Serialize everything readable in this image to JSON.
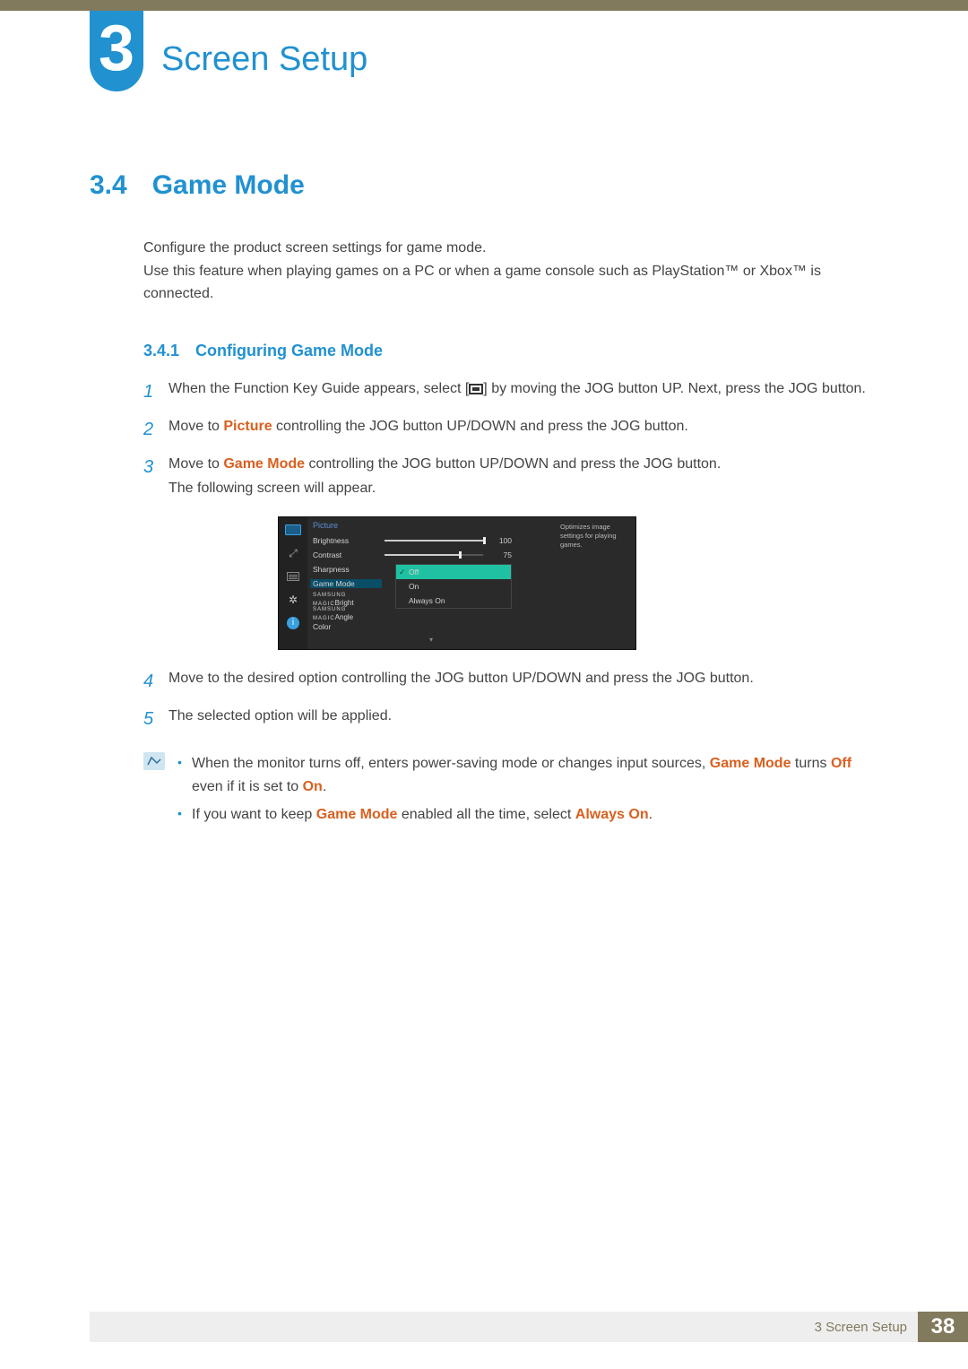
{
  "chapter": {
    "number": "3",
    "title": "Screen Setup"
  },
  "section": {
    "number": "3.4",
    "title": "Game Mode"
  },
  "intro": {
    "p1": "Configure the product screen settings for game mode.",
    "p2": "Use this feature when playing games on a PC or when a game console such as PlayStation™ or Xbox™ is connected."
  },
  "subsection": {
    "number": "3.4.1",
    "title": "Configuring Game Mode"
  },
  "steps": {
    "s1": {
      "num": "1",
      "pre": "When the Function Key Guide appears, select [",
      "post": "] by moving the JOG button UP. Next, press the JOG button."
    },
    "s2": {
      "num": "2",
      "a": "Move to ",
      "kw": "Picture",
      "b": " controlling the JOG button UP/DOWN and press the JOG button."
    },
    "s3": {
      "num": "3",
      "a": "Move to ",
      "kw": "Game Mode",
      "b": " controlling the JOG button UP/DOWN and press the JOG button.",
      "c": "The following screen will appear."
    },
    "s4": {
      "num": "4",
      "text": "Move to the desired option controlling the JOG button UP/DOWN and press the JOG button."
    },
    "s5": {
      "num": "5",
      "text": "The selected option will be applied."
    }
  },
  "osd": {
    "title": "Picture",
    "rows": {
      "brightness": {
        "label": "Brightness",
        "value": "100",
        "pct": 100
      },
      "contrast": {
        "label": "Contrast",
        "value": "75",
        "pct": 75
      },
      "sharpness": {
        "label": "Sharpness"
      },
      "gamemode": {
        "label": "Game Mode"
      },
      "magicbright_pre": "SAMSUNG",
      "magicbright": "MAGIC",
      "magicbright_suf": "Bright",
      "magicangle_pre": "SAMSUNG",
      "magicangle": "MAGIC",
      "magicangle_suf": "Angle",
      "color": {
        "label": "Color"
      }
    },
    "options": {
      "off": "Off",
      "on": "On",
      "always": "Always On"
    },
    "tip": "Optimizes image settings for playing games."
  },
  "notes": {
    "n1": {
      "a": "When the monitor turns off, enters power-saving mode or changes input sources, ",
      "kw1": "Game Mode",
      "b": " turns ",
      "kw2": "Off",
      "c": " even if it is set to ",
      "kw3": "On",
      "d": "."
    },
    "n2": {
      "a": "If you want to keep ",
      "kw1": "Game Mode",
      "b": " enabled all the time, select ",
      "kw2": "Always On",
      "c": "."
    }
  },
  "footer": {
    "text": "3 Screen Setup",
    "page": "38"
  }
}
